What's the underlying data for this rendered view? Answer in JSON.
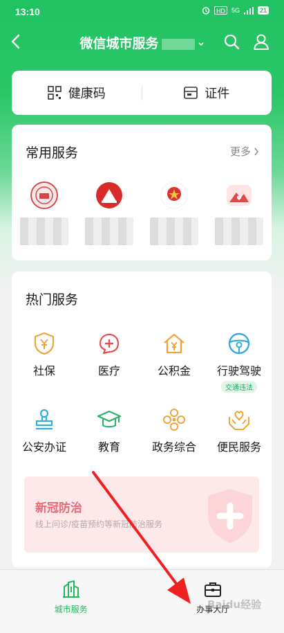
{
  "status_bar": {
    "time": "13:10",
    "hd": "HD",
    "net": "5G",
    "battery": "21"
  },
  "navbar": {
    "title": "微信城市服务"
  },
  "quick": {
    "health_code": "健康码",
    "documents": "证件"
  },
  "common": {
    "title": "常用服务",
    "more": "更多",
    "items": [
      {
        "icon": "emblem-seal-icon",
        "color": "#d64545"
      },
      {
        "icon": "red-building-logo-icon",
        "color": "#d92b2b"
      },
      {
        "icon": "national-emblem-icon",
        "color": "#d6342f"
      },
      {
        "icon": "mountain-heart-logo-icon",
        "color": "#e04848"
      }
    ]
  },
  "hot": {
    "title": "热门服务",
    "items": [
      {
        "label": "社保",
        "icon": "shield-yen-icon",
        "color": "#f0a33a",
        "badge": ""
      },
      {
        "label": "医疗",
        "icon": "medical-cross-icon",
        "color": "#e85050",
        "badge": ""
      },
      {
        "label": "公积金",
        "icon": "house-yen-icon",
        "color": "#f0a33a",
        "badge": ""
      },
      {
        "label": "行驶驾驶",
        "icon": "steering-wheel-icon",
        "color": "#36a8e0",
        "badge": "交通违法"
      },
      {
        "label": "公安办证",
        "icon": "stamp-icon",
        "color": "#36a8e0",
        "badge": ""
      },
      {
        "label": "教育",
        "icon": "graduation-cap-icon",
        "color": "#2bb36a",
        "badge": ""
      },
      {
        "label": "政务综合",
        "icon": "flower-pattern-icon",
        "color": "#f0a33a",
        "badge": ""
      },
      {
        "label": "便民服务",
        "icon": "hands-heart-icon",
        "color": "#f0a33a",
        "badge": ""
      }
    ]
  },
  "covid": {
    "title": "新冠防治",
    "subtitle": "线上问诊/疫苗预约等新冠防治服务"
  },
  "tabs": [
    {
      "label": "城市服务",
      "icon": "city-buildings-icon",
      "active": true
    },
    {
      "label": "办事大厅",
      "icon": "briefcase-icon",
      "active": false
    }
  ],
  "watermark": "Baidu经验",
  "colors": {
    "brand_green": "#21c262",
    "arrow_red": "#f02020"
  }
}
